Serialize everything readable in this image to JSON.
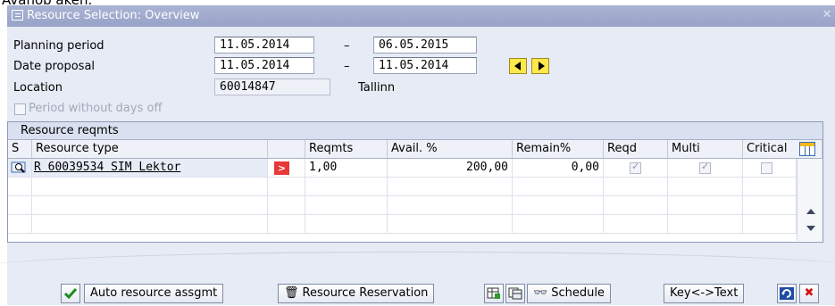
{
  "clipped_text": "Avanob aken.",
  "window": {
    "title": "Resource Selection: Overview"
  },
  "form": {
    "planning_period": {
      "label": "Planning period",
      "from": "11.05.2014",
      "to": "06.05.2015"
    },
    "date_proposal": {
      "label": "Date proposal",
      "from": "11.05.2014",
      "to": "11.05.2014"
    },
    "location": {
      "label": "Location",
      "code": "60014847",
      "name": "Tallinn"
    },
    "period_without_days_off": {
      "label": "Period without days off",
      "checked": false
    },
    "range_separator": "–"
  },
  "grid": {
    "title": "Resource reqmts",
    "headers": {
      "s": "S",
      "resource_type": "Resource type",
      "reqmts": "Reqmts",
      "avail": "Avail. %",
      "remain": "Remain%",
      "reqd": "Reqd",
      "multi": "Multi",
      "critical": "Critical"
    },
    "rows": [
      {
        "resource_type": "R 60039534 SIM Lektor",
        "reqmts": "1,00",
        "avail": "200,00",
        "remain": "0,00",
        "reqd": true,
        "multi": true,
        "critical": false
      }
    ]
  },
  "footer": {
    "auto_assign_label": "Auto resource assgmt",
    "reservation_label": "Resource Reservation",
    "schedule_label": "Schedule",
    "key_text_label": "Key<->Text"
  },
  "colors": {
    "titlebar": "#97a2c8",
    "window_bg": "#e6ebf5",
    "accent_red": "#e83838",
    "nav_yellow": "#ffe84a"
  }
}
